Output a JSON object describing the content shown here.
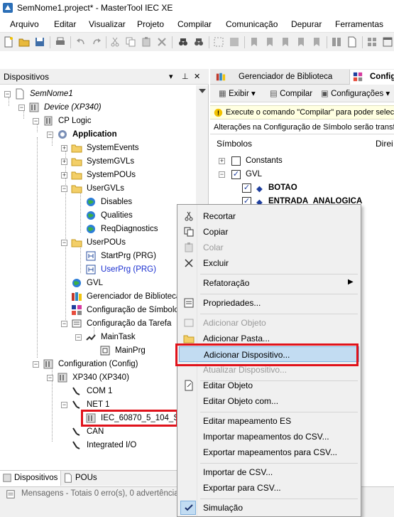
{
  "window": {
    "title": "SemNome1.project* - MasterTool IEC XE"
  },
  "menu": [
    "Arquivo",
    "Editar",
    "Visualizar",
    "Projeto",
    "Compilar",
    "Comunicação",
    "Depurar",
    "Ferramentas"
  ],
  "left_panel": {
    "title": "Dispositivos",
    "tree": {
      "project": "SemNome1",
      "device": "Device (XP340)",
      "cp_logic": "CP Logic",
      "application": "Application",
      "system_events": "SystemEvents",
      "system_gvls": "SystemGVLs",
      "system_pous": "SystemPOUs",
      "user_gvls": "UserGVLs",
      "disables": "Disables",
      "qualities": "Qualities",
      "req_diagnostics": "ReqDiagnostics",
      "user_pous": "UserPOUs",
      "start_prg": "StartPrg (PRG)",
      "user_prg": "UserPrg (PRG)",
      "gvl": "GVL",
      "lib_manager": "Gerenciador de Biblioteca",
      "symbol_config": "Configuração de Símbolo",
      "task_config": "Configuração da Tarefa",
      "main_task": "MainTask",
      "main_prg": "MainPrg",
      "configuration": "Configuration (Config)",
      "xp340": "XP340 (XP340)",
      "com1": "COM 1",
      "net1": "NET 1",
      "iec": "IEC_60870_5_104_Se",
      "can": "CAN",
      "integrated_io": "Integrated I/O"
    },
    "tabs": {
      "devices": "Dispositivos",
      "pous": "POUs"
    }
  },
  "messages": {
    "text": "Mensagens - Totais 0 erro(s), 0 advertência"
  },
  "right_panel": {
    "tabs": {
      "library": "Gerenciador de Biblioteca",
      "config": "Configu"
    },
    "toolbar": {
      "view": "Exibir",
      "compile": "Compilar",
      "configs": "Configurações"
    },
    "info1": "Execute o comando \"Compilar\" para poder selecio",
    "info2": "Alterações na Configuração de Símbolo serão transfe",
    "col_symbols": "Símbolos",
    "col_rights": "Direi",
    "items": {
      "constants": "Constants",
      "gvl": "GVL",
      "botao": "BOTAO",
      "entrada": "ENTRADA_ANALOGICA"
    }
  },
  "context_menu": {
    "items": [
      {
        "label": "Recortar",
        "enabled": true,
        "icon": "scissors-icon"
      },
      {
        "label": "Copiar",
        "enabled": true,
        "icon": "copy-icon"
      },
      {
        "label": "Colar",
        "enabled": false,
        "icon": "paste-icon"
      },
      {
        "label": "Excluir",
        "enabled": true,
        "icon": "delete-icon"
      },
      {
        "label": "Refatoração",
        "enabled": true,
        "icon": "",
        "submenu": true
      },
      {
        "label": "Propriedades...",
        "enabled": true,
        "icon": "properties-icon"
      },
      {
        "label": "Adicionar Objeto",
        "enabled": false,
        "icon": "add-object-icon"
      },
      {
        "label": "Adicionar Pasta...",
        "enabled": true,
        "icon": "folder-icon"
      },
      {
        "label": "Adicionar Dispositivo...",
        "enabled": true,
        "icon": "",
        "highlighted": true
      },
      {
        "label": "Atualizar Dispositivo...",
        "enabled": false,
        "icon": ""
      },
      {
        "label": "Editar Objeto",
        "enabled": true,
        "icon": "edit-object-icon"
      },
      {
        "label": "Editar Objeto com...",
        "enabled": true,
        "icon": ""
      },
      {
        "label": "Editar mapeamento ES",
        "enabled": true,
        "icon": ""
      },
      {
        "label": "Importar mapeamentos do CSV...",
        "enabled": true,
        "icon": ""
      },
      {
        "label": "Exportar mapeamentos para CSV...",
        "enabled": true,
        "icon": ""
      },
      {
        "label": "Importar de CSV...",
        "enabled": true,
        "icon": ""
      },
      {
        "label": "Exportar para CSV...",
        "enabled": true,
        "icon": ""
      },
      {
        "label": "Simulação",
        "enabled": true,
        "icon": "check-icon"
      }
    ]
  },
  "colors": {
    "highlight": "#c2dcf2",
    "annotation_red": "#e0121b",
    "link_blue": "#1a2fd0"
  }
}
